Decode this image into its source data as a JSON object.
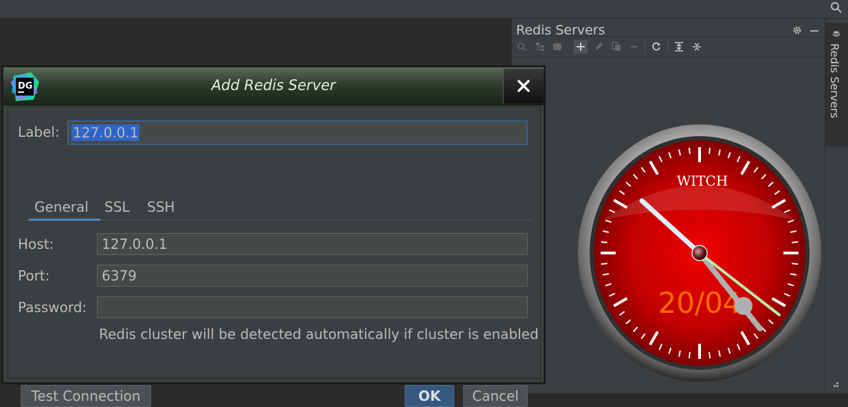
{
  "panel": {
    "title": "Redis Servers",
    "toolbar_icons": [
      "search-icon",
      "tree-icon",
      "stop-icon",
      "add-icon",
      "edit-icon",
      "copy-icon",
      "remove-icon",
      "refresh-icon",
      "expand-all-icon",
      "collapse-all-icon"
    ]
  },
  "stripe": {
    "label": "Redis Servers"
  },
  "clock": {
    "brand": "WITCH",
    "date": "20/04",
    "colors": {
      "face": "#b00000",
      "bezel": "#9a9a9a",
      "date": "#ff6a00",
      "second_hand": "#b8f0b0"
    }
  },
  "dialog": {
    "title": "Add Redis Server",
    "logo_text": "DG",
    "label": {
      "text": "Label:",
      "value": "127.0.0.1"
    },
    "tabs": [
      "General",
      "SSL",
      "SSH"
    ],
    "host": {
      "text": "Host:",
      "value": "127.0.0.1"
    },
    "port": {
      "text": "Port:",
      "value": "6379"
    },
    "password": {
      "text": "Password:",
      "value": ""
    },
    "hint": "Redis cluster will be detected automatically if cluster is enabled",
    "buttons": {
      "test": "Test Connection",
      "ok": "OK",
      "cancel": "Cancel"
    }
  },
  "colors": {
    "accent": "#4a88c7",
    "primary_button": "#365880",
    "selection": "#2f65ca"
  }
}
